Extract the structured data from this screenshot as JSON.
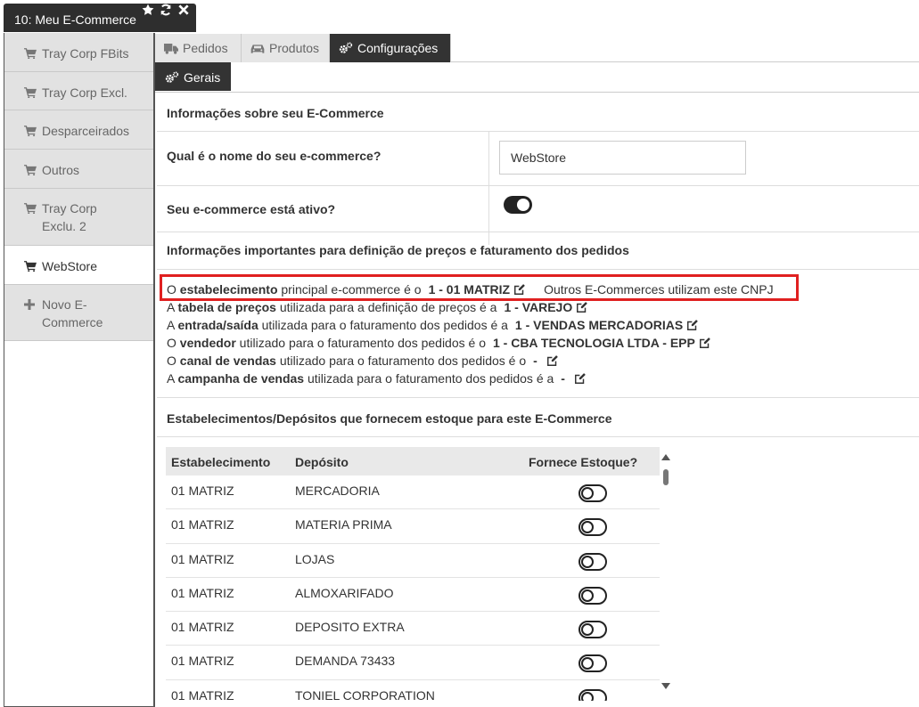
{
  "window": {
    "title": "10: Meu E-Commerce"
  },
  "sidebar": {
    "items": [
      {
        "label": "Tray Corp FBits",
        "icon": "cart-icon",
        "active": false
      },
      {
        "label": "Tray Corp Excl.",
        "icon": "cart-icon",
        "active": false
      },
      {
        "label": "Desparceirados",
        "icon": "cart-icon",
        "active": false
      },
      {
        "label": "Outros",
        "icon": "cart-icon",
        "active": false
      },
      {
        "label": "Tray Corp Exclu. 2",
        "icon": "cart-icon",
        "active": false
      },
      {
        "label": "WebStore",
        "icon": "cart-icon",
        "active": true
      },
      {
        "label": "Novo E-Commerce",
        "icon": "plus-icon",
        "active": false
      }
    ]
  },
  "tabs": [
    {
      "label": "Pedidos",
      "icon": "truck-icon",
      "active": false
    },
    {
      "label": "Produtos",
      "icon": "car-icon",
      "active": false
    },
    {
      "label": "Configurações",
      "icon": "gears-icon",
      "active": true
    }
  ],
  "subtab": {
    "label": "Gerais",
    "icon": "gears-icon"
  },
  "section1": {
    "title": "Informações sobre seu E-Commerce",
    "name_label": "Qual é o nome do seu e-commerce?",
    "name_value": "WebStore",
    "active_label": "Seu e-commerce está ativo?",
    "active": true
  },
  "section2": {
    "title": "Informações importantes para definição de preços e faturamento dos pedidos",
    "lines": [
      {
        "pre": "O ",
        "key": "estabelecimento",
        "post": " principal e-commerce é o",
        "value": "1 - 01 MATRIZ",
        "extra": "Outros E-Commerces utilizam este CNPJ"
      },
      {
        "pre": "A ",
        "key": "tabela de preços",
        "post": " utilizada para a definição de preços é a",
        "value": "1 - VAREJO",
        "extra": ""
      },
      {
        "pre": "A ",
        "key": "entrada/saída",
        "post": " utilizada para o faturamento dos pedidos é a",
        "value": "1 - VENDAS MERCADORIAS",
        "extra": ""
      },
      {
        "pre": "O ",
        "key": "vendedor",
        "post": " utilizado para o faturamento dos pedidos é o",
        "value": "1 - CBA TECNOLOGIA LTDA - EPP",
        "extra": ""
      },
      {
        "pre": "O ",
        "key": "canal de vendas",
        "post": " utilizado para o faturamento dos pedidos é o",
        "value": "-",
        "extra": ""
      },
      {
        "pre": "A ",
        "key": "campanha de vendas",
        "post": " utilizada para o faturamento dos pedidos é a",
        "value": "-",
        "extra": ""
      }
    ]
  },
  "section3": {
    "title": "Estabelecimentos/Depósitos que fornecem estoque para este E-Commerce",
    "columns": [
      "Estabelecimento",
      "Depósito",
      "Fornece Estoque?"
    ],
    "rows": [
      {
        "estab": "01 MATRIZ",
        "deposito": "MERCADORIA",
        "fornece": false
      },
      {
        "estab": "01 MATRIZ",
        "deposito": "MATERIA PRIMA",
        "fornece": false
      },
      {
        "estab": "01 MATRIZ",
        "deposito": "LOJAS",
        "fornece": false
      },
      {
        "estab": "01 MATRIZ",
        "deposito": "ALMOXARIFADO",
        "fornece": false
      },
      {
        "estab": "01 MATRIZ",
        "deposito": "DEPOSITO EXTRA",
        "fornece": false
      },
      {
        "estab": "01 MATRIZ",
        "deposito": "DEMANDA 73433",
        "fornece": false
      },
      {
        "estab": "01 MATRIZ",
        "deposito": "TONIEL CORPORATION",
        "fornece": false
      }
    ]
  },
  "colors": {
    "dark": "#333333",
    "highlight": "#e02020",
    "tab_inactive": "#e6e6e6"
  }
}
